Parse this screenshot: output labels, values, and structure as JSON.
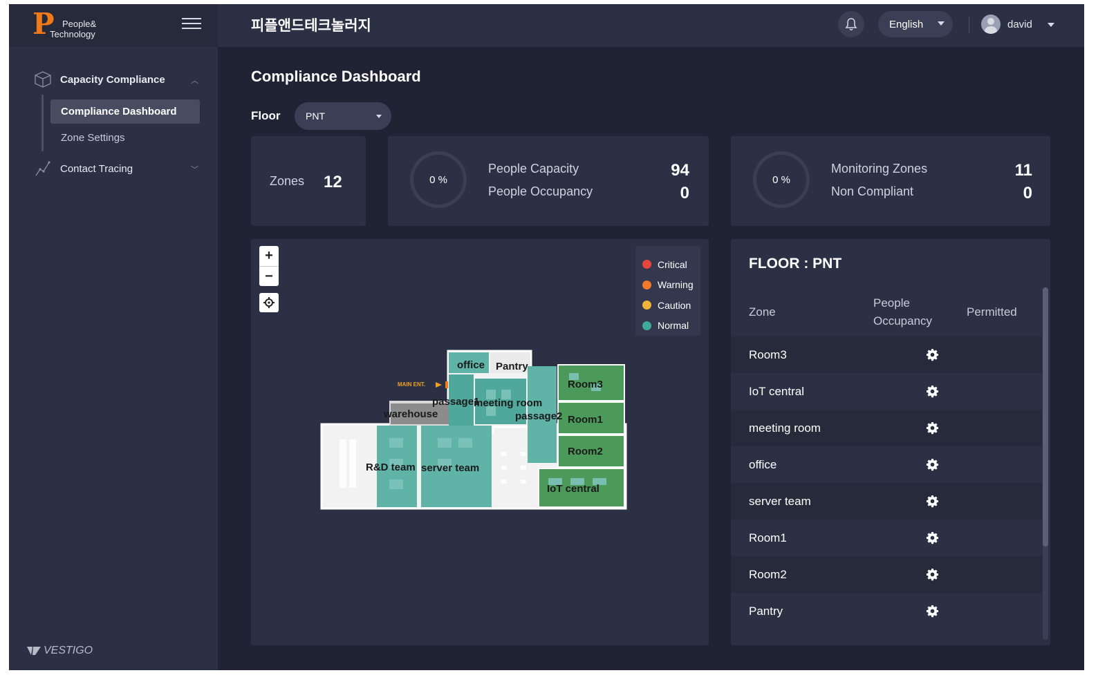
{
  "brand": {
    "logo_line1": "People&",
    "logo_line2": "Technology",
    "footer_logo": "VESTIGO"
  },
  "topbar": {
    "company_name": "피플앤드테크놀러지",
    "language": "English",
    "user_name": "david"
  },
  "sidebar": {
    "groups": [
      {
        "label": "Capacity Compliance",
        "expanded": true,
        "items": [
          {
            "label": "Compliance Dashboard",
            "active": true
          },
          {
            "label": "Zone Settings",
            "active": false
          }
        ]
      },
      {
        "label": "Contact Tracing",
        "expanded": false,
        "items": []
      }
    ]
  },
  "main": {
    "title": "Compliance Dashboard",
    "floor_label": "Floor",
    "floor_value": "PNT"
  },
  "stats": {
    "zones": {
      "label": "Zones",
      "value": "12"
    },
    "people": {
      "percent": "0 %",
      "capacity_label": "People Capacity",
      "capacity_value": "94",
      "occupancy_label": "People Occupancy",
      "occupancy_value": "0"
    },
    "monitoring": {
      "percent": "0 %",
      "zones_label": "Monitoring Zones",
      "zones_value": "11",
      "noncompliant_label": "Non Compliant",
      "noncompliant_value": "0"
    }
  },
  "map": {
    "zoom_in": "+",
    "zoom_out": "−",
    "legend": [
      {
        "label": "Critical",
        "color": "#e8463c"
      },
      {
        "label": "Warning",
        "color": "#f07a2a"
      },
      {
        "label": "Caution",
        "color": "#f0b43a"
      },
      {
        "label": "Normal",
        "color": "#3fa99a"
      }
    ],
    "entrance_label": "MAIN ENT.",
    "rooms": {
      "office": "office",
      "pantry": "Pantry",
      "room3": "Room3",
      "passage1": "passage1",
      "meeting_room": "meeting room",
      "warehouse": "warehouse",
      "passage2": "passage2",
      "room1": "Room1",
      "room2": "Room2",
      "rd_team": "R&D team",
      "server_team": "server team",
      "iot_central": "IoT central"
    }
  },
  "zone_table": {
    "title": "FLOOR : PNT",
    "col_zone": "Zone",
    "col_occupancy_line1": "People",
    "col_occupancy_line2": "Occupancy",
    "col_permitted": "Permitted",
    "rows": [
      {
        "zone": "Room3"
      },
      {
        "zone": "IoT central"
      },
      {
        "zone": "meeting room"
      },
      {
        "zone": "office"
      },
      {
        "zone": "server team"
      },
      {
        "zone": "Room1"
      },
      {
        "zone": "Room2"
      },
      {
        "zone": "Pantry"
      }
    ]
  },
  "icons": {
    "menu": "hamburger-icon",
    "notifications": "bell-icon",
    "user": "avatar-icon",
    "capacity": "cube-icon",
    "tracing": "chart-line-icon",
    "row_action": "gear-icon",
    "locate": "crosshair-icon"
  }
}
